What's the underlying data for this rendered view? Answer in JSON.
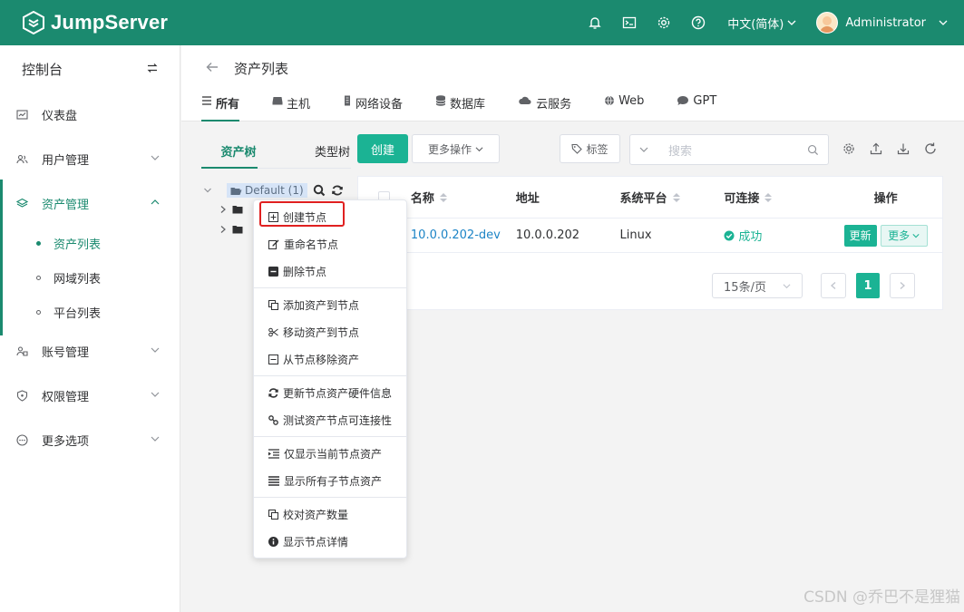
{
  "app": {
    "name": "JumpServer"
  },
  "header": {
    "language": "中文(简体)",
    "user": "Administrator"
  },
  "sidebar": {
    "title": "控制台",
    "items": [
      {
        "label": "仪表盘"
      },
      {
        "label": "用户管理"
      },
      {
        "label": "资产管理"
      },
      {
        "label": "账号管理"
      },
      {
        "label": "权限管理"
      },
      {
        "label": "更多选项"
      }
    ],
    "asset_sub": [
      {
        "label": "资产列表"
      },
      {
        "label": "网域列表"
      },
      {
        "label": "平台列表"
      }
    ]
  },
  "page": {
    "title": "资产列表",
    "tabs": [
      {
        "label": "所有"
      },
      {
        "label": "主机"
      },
      {
        "label": "网络设备"
      },
      {
        "label": "数据库"
      },
      {
        "label": "云服务"
      },
      {
        "label": "Web"
      },
      {
        "label": "GPT"
      }
    ]
  },
  "tree": {
    "tabs": [
      "资产树",
      "类型树"
    ],
    "root": "Default (1)"
  },
  "toolbar": {
    "create": "创建",
    "more": "更多操作",
    "tag": "标签",
    "search_placeholder": "搜索"
  },
  "table": {
    "columns": [
      "名称",
      "地址",
      "系统平台",
      "可连接",
      "操作"
    ],
    "rows": [
      {
        "name": "10.0.0.202-dev",
        "address": "10.0.0.202",
        "platform": "Linux",
        "connectivity": "成功",
        "update": "更新",
        "more": "更多"
      }
    ]
  },
  "pager": {
    "size": "15条/页",
    "page": "1"
  },
  "context_menu": {
    "groups": [
      [
        "创建节点",
        "重命名节点",
        "删除节点"
      ],
      [
        "添加资产到节点",
        "移动资产到节点",
        "从节点移除资产"
      ],
      [
        "更新节点资产硬件信息",
        "测试资产节点可连接性"
      ],
      [
        "仅显示当前节点资产",
        "显示所有子节点资产"
      ],
      [
        "校对资产数量",
        "显示节点详情"
      ]
    ]
  },
  "watermark": "CSDN @乔巴不是狸猫",
  "colors": {
    "brand": "#1b8a6f",
    "primary": "#1bb394",
    "link": "#1c84c6"
  }
}
